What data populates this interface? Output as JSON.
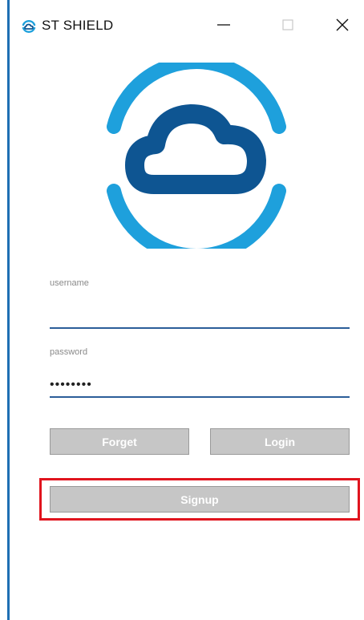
{
  "window": {
    "title": "ST SHIELD",
    "app_icon": "shield-logo-icon",
    "controls": [
      "minimize-icon",
      "maximize-icon",
      "close-icon"
    ]
  },
  "logo": {
    "icon": "cloud-shield-logo",
    "colors": {
      "outer_arc": "#1ea0dc",
      "cloud": "#0e5592"
    }
  },
  "form": {
    "username": {
      "label": "username",
      "value": ""
    },
    "password": {
      "label": "password",
      "value": "••••••••"
    }
  },
  "buttons": {
    "forget": "Forget",
    "login": "Login",
    "signup": "Signup"
  },
  "colors": {
    "accent": "#2b5e99",
    "button_bg": "#c6c6c6",
    "highlight": "#e0141e"
  }
}
